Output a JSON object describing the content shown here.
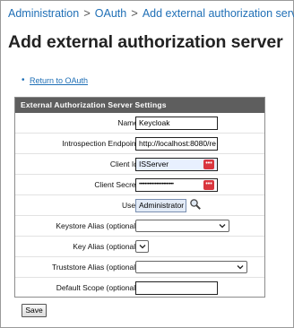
{
  "breadcrumb": {
    "items": [
      "Administration",
      "OAuth",
      "Add external authorization server"
    ],
    "separator": ">"
  },
  "page": {
    "title": "Add external authorization server"
  },
  "links": {
    "return": "Return to OAuth"
  },
  "panel": {
    "title": "External Authorization Server Settings"
  },
  "fields": {
    "name": {
      "label": "Name",
      "value": "Keycloak"
    },
    "introspection": {
      "label": "Introspection Endpoint",
      "value": "http://localhost:8080/re"
    },
    "client_id": {
      "label": "Client Id",
      "value": "ISServer"
    },
    "client_secret": {
      "label": "Client Secret",
      "value": "••••••••••••••••••••••••"
    },
    "user": {
      "label": "User",
      "value": "Administrator"
    },
    "keystore_alias": {
      "label": "Keystore Alias (optional)",
      "value": ""
    },
    "key_alias": {
      "label": "Key Alias (optional)",
      "value": ""
    },
    "truststore_alias": {
      "label": "Truststore Alias (optional)",
      "value": ""
    },
    "default_scope": {
      "label": "Default Scope (optional)",
      "value": ""
    }
  },
  "buttons": {
    "save": "Save"
  },
  "icons": {
    "password_manager": "password-manager-icon",
    "search": "search-icon",
    "chevron": "chevron-down-icon"
  },
  "colors": {
    "link": "#1f6fb6",
    "header_bg": "#5e5e5e",
    "password_icon": "#d9363e"
  }
}
